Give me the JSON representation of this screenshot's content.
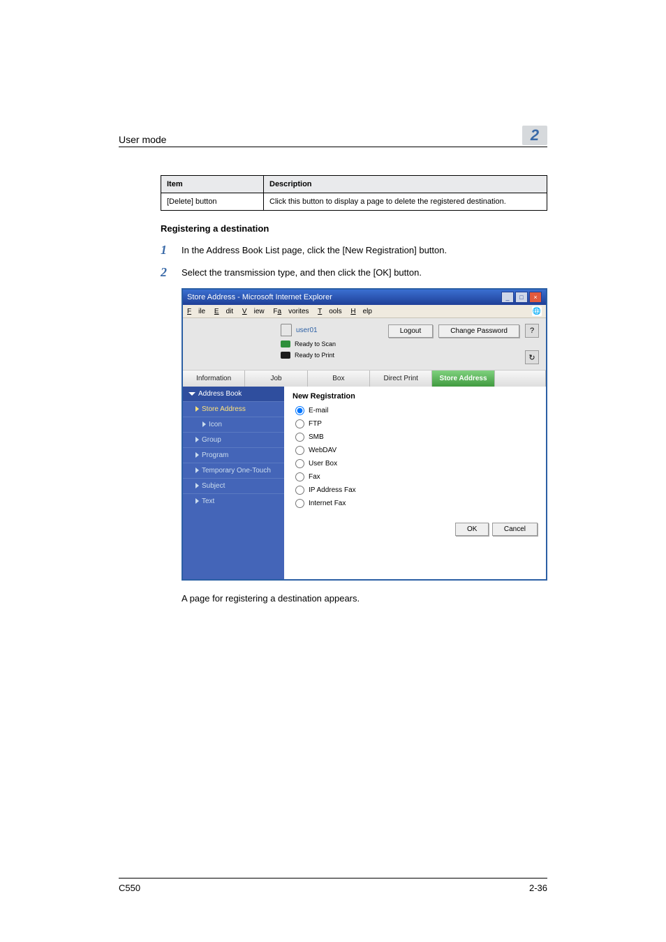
{
  "header": {
    "running_head": "User mode",
    "chapter_number": "2"
  },
  "table": {
    "columns": [
      "Item",
      "Description"
    ],
    "rows": [
      {
        "item": "[Delete] button",
        "desc": "Click this button to display a page to delete the registered destination."
      }
    ]
  },
  "section_title": "Registering a destination",
  "steps": [
    {
      "n": "1",
      "t": "In the Address Book List page, click the [New Registration] button."
    },
    {
      "n": "2",
      "t": "Select the transmission type, and then click the [OK] button."
    }
  ],
  "screenshot": {
    "window_title": "Store Address - Microsoft Internet Explorer",
    "menu": {
      "file": "File",
      "edit": "Edit",
      "view": "View",
      "favorites": "Favorites",
      "tools": "Tools",
      "help": "Help"
    },
    "user": "user01",
    "logout": "Logout",
    "change_password": "Change Password",
    "status": {
      "scan": "Ready to Scan",
      "print": "Ready to Print"
    },
    "tabs": {
      "info": "Information",
      "job": "Job",
      "box": "Box",
      "direct": "Direct Print",
      "store": "Store Address"
    },
    "sidebar": {
      "header": "Address Book",
      "items": [
        {
          "label": "Store Address",
          "sel": true,
          "indent": 1
        },
        {
          "label": "Icon",
          "sel": false,
          "indent": 2
        },
        {
          "label": "Group",
          "sel": false,
          "indent": 0
        },
        {
          "label": "Program",
          "sel": false,
          "indent": 0
        },
        {
          "label": "Temporary One-Touch",
          "sel": false,
          "indent": 0
        },
        {
          "label": "Subject",
          "sel": false,
          "indent": 0
        },
        {
          "label": "Text",
          "sel": false,
          "indent": 0
        }
      ]
    },
    "panel_title": "New Registration",
    "radios": [
      {
        "label": "E-mail",
        "checked": true
      },
      {
        "label": "FTP",
        "checked": false
      },
      {
        "label": "SMB",
        "checked": false
      },
      {
        "label": "WebDAV",
        "checked": false
      },
      {
        "label": "User Box",
        "checked": false
      },
      {
        "label": "Fax",
        "checked": false
      },
      {
        "label": "IP Address Fax",
        "checked": false
      },
      {
        "label": "Internet Fax",
        "checked": false
      }
    ],
    "ok": "OK",
    "cancel": "Cancel"
  },
  "caption": "A page for registering a destination appears.",
  "footer": {
    "model": "C550",
    "page": "2-36"
  }
}
